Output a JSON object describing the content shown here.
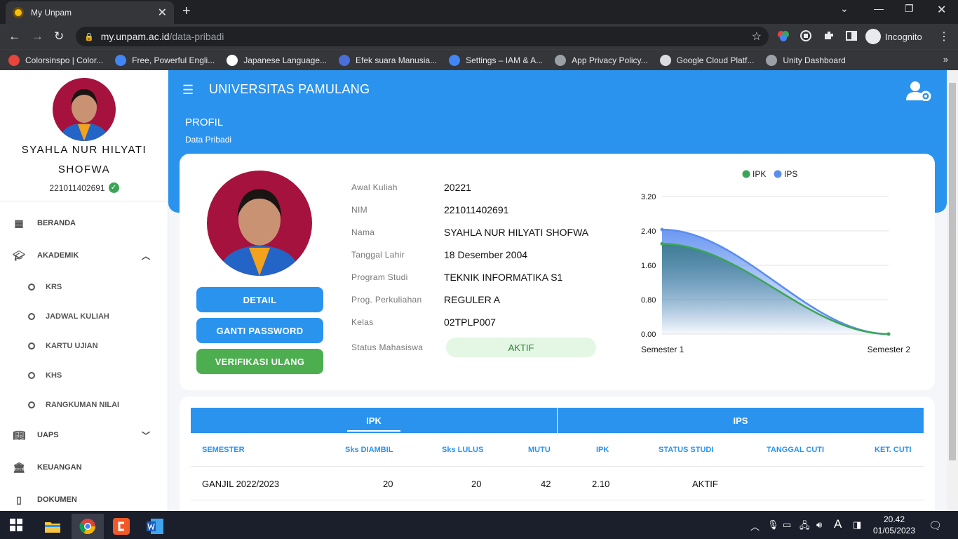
{
  "browser": {
    "tab_title": "My Unpam",
    "url_host": "my.unpam.ac.id",
    "url_path": "/data-pribadi",
    "profile_label": "Incognito",
    "bookmarks": [
      {
        "label": "Colorsinspo | Color...",
        "color": "#e8453c"
      },
      {
        "label": "Free, Powerful Engli...",
        "color": "#4285f4"
      },
      {
        "label": "Japanese Language...",
        "color": "#ffffff"
      },
      {
        "label": "Efek suara Manusia...",
        "color": "#4a6fd8"
      },
      {
        "label": "Settings – IAM & A...",
        "color": "#4285f4"
      },
      {
        "label": "App Privacy Policy...",
        "color": "#9aa0a6"
      },
      {
        "label": "Google Cloud Platf...",
        "color": "#dadce0"
      },
      {
        "label": "Unity Dashboard",
        "color": "#9aa0a6"
      }
    ]
  },
  "sidebar": {
    "name": "SYAHLA NUR HILYATI SHOFWA",
    "nim": "221011402691",
    "items": [
      {
        "label": "BERANDA",
        "icon": "dashboard-icon"
      },
      {
        "label": "AKADEMIK",
        "icon": "graduation-cap-icon"
      },
      {
        "label": "UAPS",
        "icon": "book-icon"
      },
      {
        "label": "KEUANGAN",
        "icon": "bank-icon"
      },
      {
        "label": "DOKUMEN",
        "icon": "document-icon"
      }
    ],
    "subitems": [
      "KRS",
      "JADWAL KULIAH",
      "KARTU UJIAN",
      "KHS",
      "RANGKUMAN NILAI"
    ]
  },
  "header": {
    "brand": "UNIVERSITAS PAMULANG",
    "page_title": "PROFIL",
    "page_subtitle": "Data Pribadi"
  },
  "profile": {
    "buttons": {
      "detail": "DETAIL",
      "password": "GANTI PASSWORD",
      "verify": "VERIFIKASI ULANG"
    },
    "fields": [
      {
        "label": "Awal Kuliah",
        "value": "20221"
      },
      {
        "label": "NIM",
        "value": "221011402691"
      },
      {
        "label": "Nama",
        "value": "SYAHLA NUR HILYATI SHOFWA"
      },
      {
        "label": "Tanggal Lahir",
        "value": "18 Desember 2004"
      },
      {
        "label": "Program Studi",
        "value": "TEKNIK INFORMATIKA S1"
      },
      {
        "label": "Prog. Perkuliahan",
        "value": "REGULER A"
      },
      {
        "label": "Kelas",
        "value": "02TPLP007"
      }
    ],
    "status_label": "Status Mahasiswa",
    "status_value": "AKTIF"
  },
  "chart_data": {
    "type": "area",
    "categories": [
      "Semester 1",
      "Semester 2"
    ],
    "series": [
      {
        "name": "IPK",
        "values": [
          2.1,
          0.0
        ],
        "color": "#3aa655"
      },
      {
        "name": "IPS",
        "values": [
          2.43,
          0.0
        ],
        "color": "#5b8def"
      }
    ],
    "yticks": [
      "0.00",
      "0.80",
      "1.60",
      "2.40",
      "3.20"
    ],
    "ylim": [
      0,
      3.2
    ],
    "legend_position": "top-center",
    "grid": true
  },
  "table": {
    "tabs": [
      "IPK",
      "IPS"
    ],
    "columns": [
      "SEMESTER",
      "Sks DIAMBIL",
      "Sks LULUS",
      "MUTU",
      "IPK",
      "STATUS STUDI",
      "TANGGAL CUTI",
      "KET. CUTI"
    ],
    "rows": [
      [
        "GANJIL 2022/2023",
        "20",
        "20",
        "42",
        "2.10",
        "AKTIF",
        "",
        ""
      ]
    ]
  },
  "taskbar": {
    "time": "20.42",
    "date": "01/05/2023"
  }
}
